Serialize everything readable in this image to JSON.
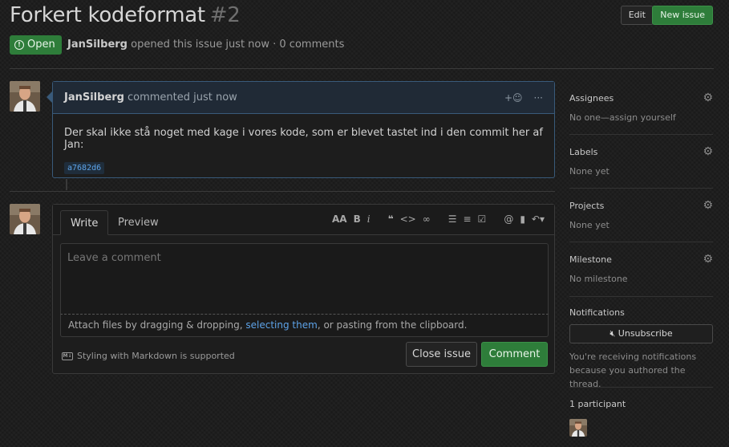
{
  "issue": {
    "title": "Forkert kodeformat",
    "number": "#2",
    "state": "Open",
    "author": "JanSilberg",
    "meta_rest": "opened this issue just now · 0 comments"
  },
  "header_buttons": {
    "edit": "Edit",
    "new_issue": "New issue"
  },
  "comment": {
    "author": "JanSilberg",
    "action": "commented just now",
    "reaction_icon": "+☺",
    "more_icon": "···",
    "body": "Der skal ikke stå noget med kage i vores kode, som er blevet tastet ind i den commit her af Jan:",
    "commit_sha": "a7682d6"
  },
  "editor": {
    "tabs": {
      "write": "Write",
      "preview": "Preview"
    },
    "placeholder": "Leave a comment",
    "attach_before": "Attach files by dragging & dropping, ",
    "attach_link": "selecting them",
    "attach_after": ", or pasting from the clipboard.",
    "markdown_note": "Styling with Markdown is supported",
    "close_button": "Close issue",
    "comment_button": "Comment"
  },
  "sidebar": {
    "assignees": {
      "label": "Assignees",
      "value": "No one—assign yourself"
    },
    "labels": {
      "label": "Labels",
      "value": "None yet"
    },
    "projects": {
      "label": "Projects",
      "value": "None yet"
    },
    "milestone": {
      "label": "Milestone",
      "value": "No milestone"
    },
    "notifications": {
      "label": "Notifications",
      "button": "Unsubscribe",
      "note": "You're receiving notifications because you authored the thread."
    },
    "participants": {
      "label": "1 participant"
    }
  },
  "colors": {
    "accent_green": "#2e7d3a",
    "link_blue": "#5da3e8",
    "comment_border": "#395a7a"
  }
}
